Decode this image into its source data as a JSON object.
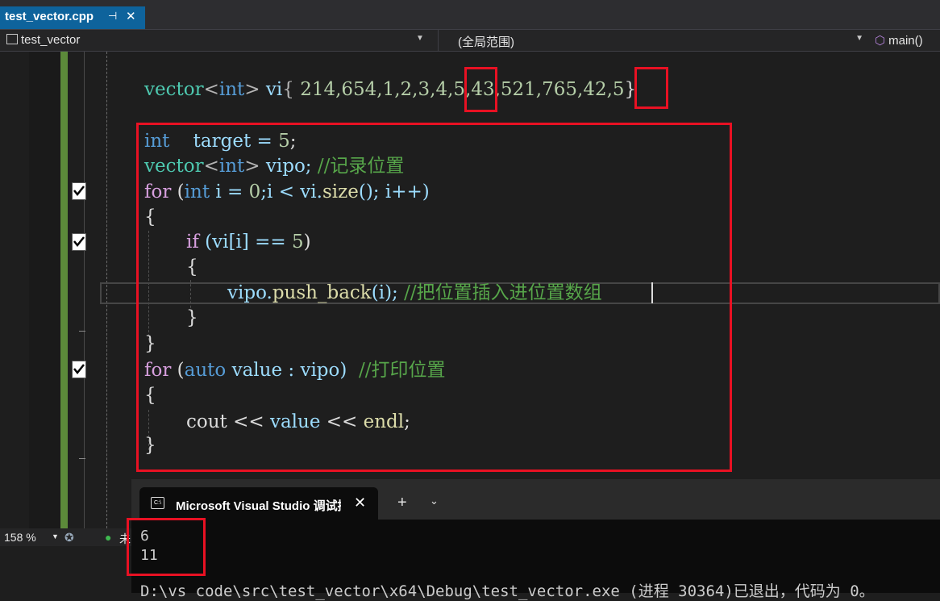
{
  "tab": {
    "filename": "test_vector.cpp",
    "pin": "⊣",
    "close": "✕"
  },
  "nav": {
    "project": "test_vector",
    "scope": "(全局范围)",
    "function": "main()"
  },
  "code": {
    "line1": [
      "vector",
      "<",
      "int",
      ">",
      " vi",
      "{ ",
      "214,654,1,2,3,4,5,43,521,765,42,5",
      "}"
    ],
    "l_int": "int",
    "l_int_rest": "    target = ",
    "l_int_num": "5",
    "l_int_end": ";",
    "l_vec_a": "vector",
    "l_vec_b": "<",
    "l_vec_c": "int",
    "l_vec_d": ">",
    "l_vec_e": " vipo; ",
    "l_vec_cm": "//记录位置",
    "for1_kw": "for",
    "for1_a": " (",
    "for1_int": "int",
    "for1_b": " i = ",
    "for1_zero": "0",
    "for1_c": ";i < vi.",
    "for1_fn": "size",
    "for1_d": "(); i++)",
    "brace_open": "{",
    "if_kw": "if",
    "if_rest_a": " (vi[i] == ",
    "if_num": "5",
    "if_rest_b": ")",
    "inner_open": "{",
    "push_a": "vipo.",
    "push_fn": "push_back",
    "push_b": "(i); ",
    "push_cm": "//把位置插入进位置数组",
    "inner_close": "}",
    "brace_close": "}",
    "for2_kw": "for",
    "for2_a": " (",
    "for2_auto": "auto",
    "for2_b": " value : vipo)  ",
    "for2_cm": "//打印位置",
    "brace2_open": "{",
    "cout_a": "cout << ",
    "cout_val": "value",
    "cout_b": " << ",
    "cout_endl": "endl",
    "cout_c": ";",
    "brace2_close": "}"
  },
  "status": {
    "zoom": "158 %",
    "issues_cut": "未"
  },
  "console": {
    "title": "Microsoft Visual Studio 调试控制台",
    "icon_text": "C:\\",
    "plus": "+",
    "output": [
      "6",
      "11"
    ],
    "exit_line": "D:\\vs code\\src\\test_vector\\x64\\Debug\\test_vector.exe (进程 30364)已退出，代码为 0。"
  }
}
